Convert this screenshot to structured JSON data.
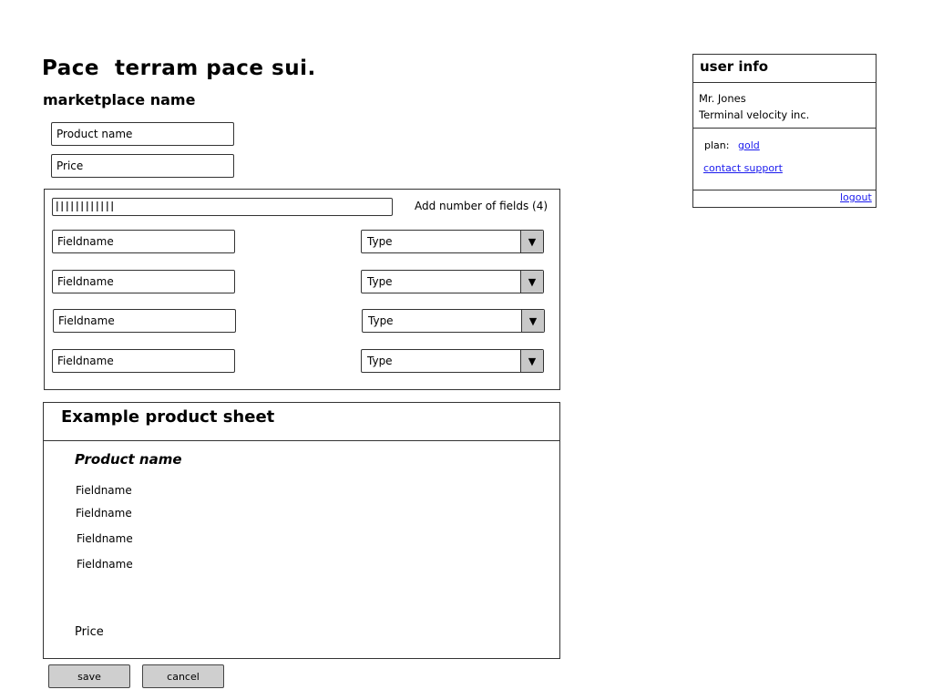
{
  "page": {
    "title": "Pace  terram pace sui.",
    "subtitle": "marketplace name"
  },
  "form": {
    "product_name_placeholder": "Product name",
    "price_placeholder": "Price"
  },
  "fields_panel": {
    "slider_value": 4,
    "add_label": "Add number of fields (4)",
    "rows": [
      {
        "fieldname": "Fieldname",
        "type": "Type"
      },
      {
        "fieldname": "Fieldname",
        "type": "Type"
      },
      {
        "fieldname": "Fieldname",
        "type": "Type"
      },
      {
        "fieldname": "Fieldname",
        "type": "Type"
      }
    ],
    "dropdown_icon": "triangle-down-icon"
  },
  "sheet": {
    "title": "Example product sheet",
    "product_name": "Product name",
    "fields": [
      "Fieldname",
      "Fieldname",
      "Fieldname",
      "Fieldname"
    ],
    "price": "Price"
  },
  "actions": {
    "save": "save",
    "cancel": "cancel"
  },
  "user_info": {
    "title": "user info",
    "name": "Mr. Jones",
    "company": "Terminal velocity inc.",
    "plan_label": "plan:",
    "plan_value": "gold",
    "contact": "contact support",
    "logout": "logout"
  },
  "colors": {
    "link": "#1a1aee",
    "button_bg": "#cfcfcf",
    "dropdown_arrow_bg": "#c8c8c8",
    "border": "#333333"
  }
}
